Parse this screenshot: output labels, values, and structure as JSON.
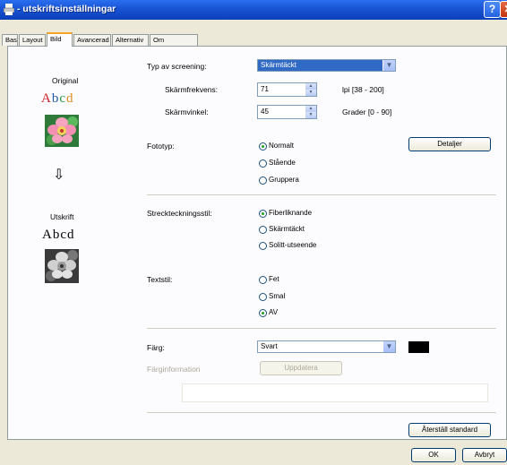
{
  "window": {
    "title": "- utskriftsinställningar",
    "help_glyph": "?",
    "close_glyph": "✕"
  },
  "tabs": [
    "Bas",
    "Layout",
    "Bild",
    "Avancerad",
    "Alternativ",
    "Om"
  ],
  "preview": {
    "original_label": "Original",
    "output_label": "Utskrift",
    "sample_text_chars": [
      "A",
      "b",
      "c",
      "d"
    ],
    "sample_text_colors": [
      "#cc2222",
      "#2255aa",
      "#229944",
      "#dd8822"
    ],
    "arrow_glyph": "⇩"
  },
  "screening": {
    "label": "Typ av screening:",
    "value": "Skärmtäckt",
    "freq_label": "Skärmfrekvens:",
    "freq_value": "71",
    "freq_range": "lpi [38 - 200]",
    "angle_label": "Skärmvinkel:",
    "angle_value": "45",
    "angle_range": "Grader [0 - 90]"
  },
  "photo": {
    "label": "Fototyp:",
    "options": [
      "Normalt",
      "Stående",
      "Gruppera"
    ],
    "selected": 0,
    "details_button": "Detaljer"
  },
  "lineart": {
    "label": "Streckteckningsstil:",
    "options": [
      "Fiberliknande",
      "Skärmtäckt",
      "Solitt-utseende"
    ],
    "selected": 0
  },
  "textstyle": {
    "label": "Textstil:",
    "options": [
      "Fet",
      "Smal",
      "AV"
    ],
    "selected": 2
  },
  "color": {
    "label": "Färg:",
    "value": "Svart",
    "swatch": "#000000",
    "info_label": "Färginformation",
    "update_button": "Uppdatera"
  },
  "reset_button": "Återställ standard",
  "ok_button": "OK",
  "cancel_button": "Avbryt"
}
